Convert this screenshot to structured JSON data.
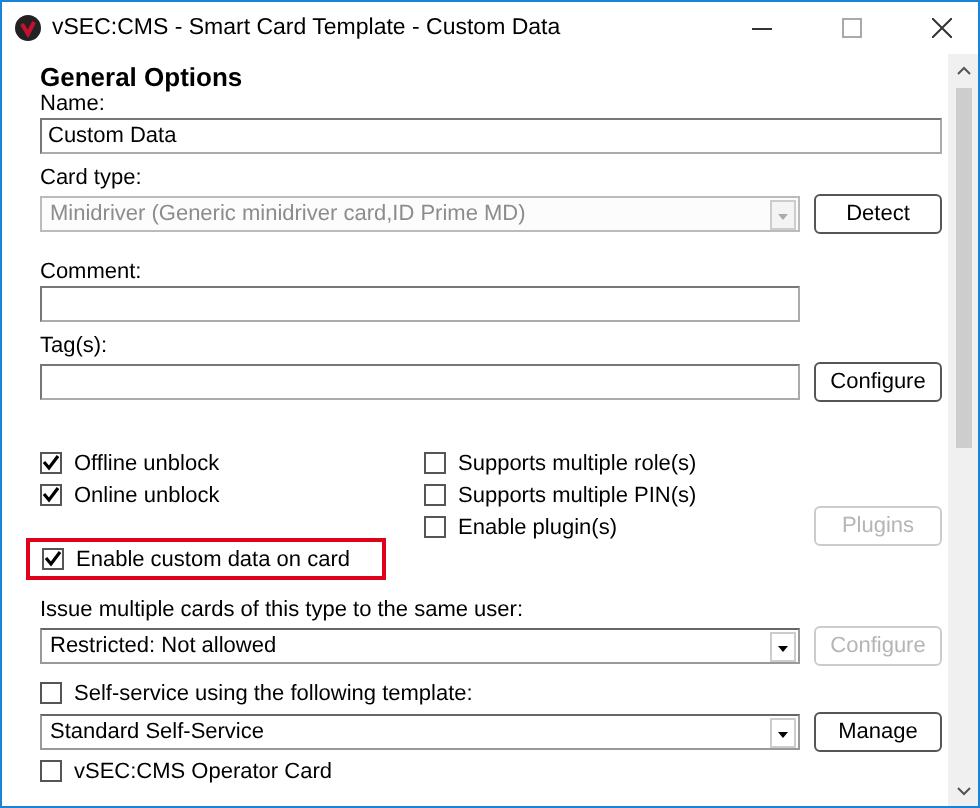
{
  "window": {
    "title": "vSEC:CMS - Smart Card Template - Custom Data"
  },
  "section_title": "General Options",
  "name": {
    "label": "Name:",
    "value": "Custom Data"
  },
  "card_type": {
    "label": "Card type:",
    "value": "Minidriver (Generic minidriver card,ID Prime MD)",
    "disabled": true,
    "button": {
      "label": "Detect",
      "disabled": false
    }
  },
  "comment": {
    "label": "Comment:"
  },
  "tags": {
    "label": "Tag(s):",
    "button": {
      "label": "Configure",
      "disabled": false
    }
  },
  "left_options": [
    {
      "label": "Offline unblock",
      "checked": true
    },
    {
      "label": "Online unblock",
      "checked": true
    }
  ],
  "right_options": [
    {
      "label": "Supports multiple role(s)",
      "checked": false
    },
    {
      "label": "Supports multiple PIN(s)",
      "checked": false
    },
    {
      "label": "Enable plugin(s)",
      "checked": false
    }
  ],
  "plugins_button": {
    "label": "Plugins",
    "disabled": true
  },
  "custom_data": {
    "label": "Enable custom data on card",
    "checked": true,
    "highlighted": true
  },
  "issue_multiple": {
    "label": "Issue multiple cards of this type to the same user:",
    "value": "Restricted: Not allowed",
    "disabled": false,
    "button": {
      "label": "Configure",
      "disabled": true
    }
  },
  "self_service": {
    "label": "Self-service using the following template:",
    "checked": false
  },
  "template": {
    "value": "Standard Self-Service",
    "disabled": false,
    "button": {
      "label": "Manage",
      "disabled": false
    }
  },
  "operator_card": {
    "label": "vSEC:CMS Operator Card",
    "checked": false
  }
}
